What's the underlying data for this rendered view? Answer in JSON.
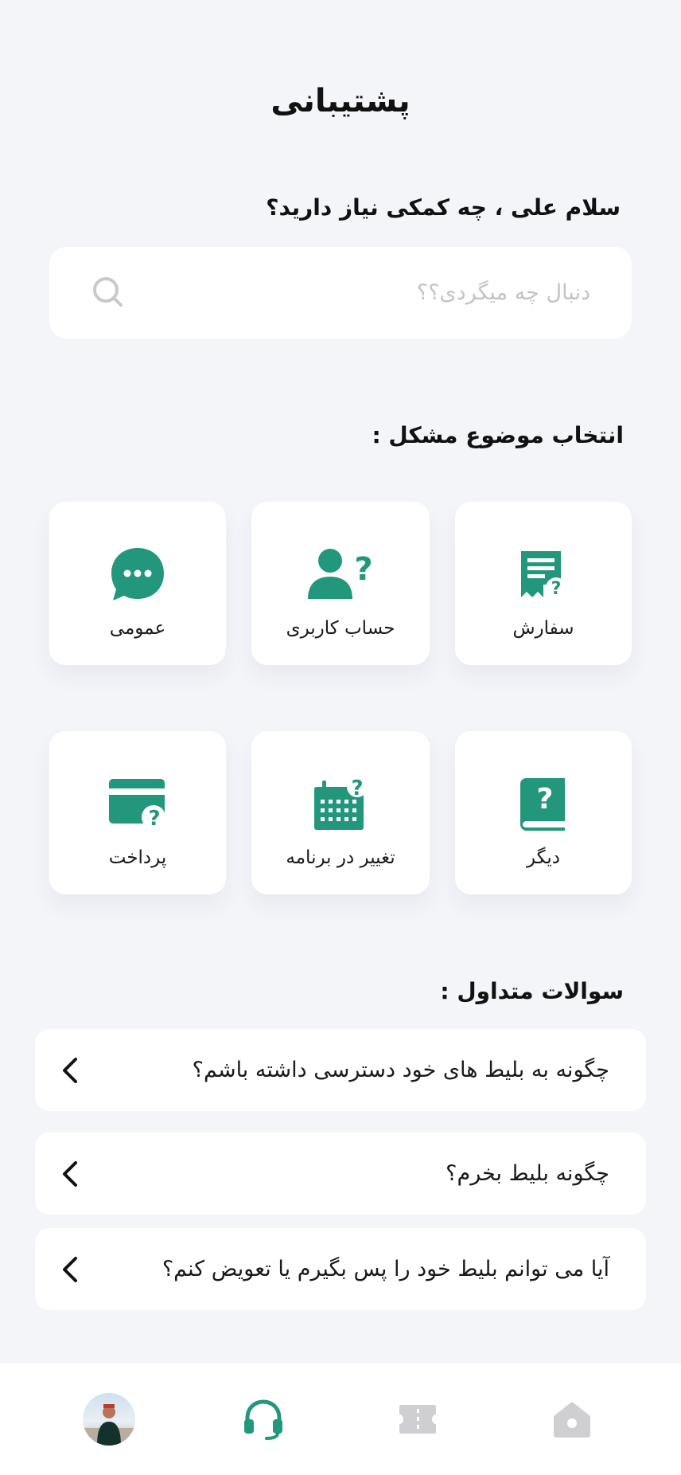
{
  "header": {
    "title": "پشتیبانی"
  },
  "greeting": "سلام علی ، چه کمکی نیاز دارید؟",
  "search": {
    "placeholder": "دنبال چه میگردی؟؟",
    "value": ""
  },
  "topics": {
    "title": "انتخاب موضوع مشکل :",
    "items": [
      {
        "label": "سفارش",
        "icon": "receipt-question-icon"
      },
      {
        "label": "حساب کاربری",
        "icon": "user-question-icon"
      },
      {
        "label": "عمومی",
        "icon": "chat-bubble-icon"
      },
      {
        "label": "دیگر",
        "icon": "book-question-icon"
      },
      {
        "label": "تغییر در برنامه",
        "icon": "calendar-question-icon"
      },
      {
        "label": "پرداخت",
        "icon": "card-question-icon"
      }
    ]
  },
  "faq": {
    "title": "سوالات متداول :",
    "items": [
      {
        "question": "چگونه به بلیط های خود دسترسی داشته باشم؟"
      },
      {
        "question": "چگونه بلیط بخرم؟"
      },
      {
        "question": "آیا می توانم بلیط خود را پس بگیرم یا تعویض کنم؟"
      }
    ]
  },
  "bottom_nav": {
    "items": [
      {
        "icon": "home-icon",
        "active": false
      },
      {
        "icon": "ticket-icon",
        "active": false
      },
      {
        "icon": "headset-icon",
        "active": true
      },
      {
        "icon": "avatar",
        "active": false
      }
    ]
  },
  "colors": {
    "accent": "#23977b",
    "background": "#f4f5f9",
    "inactive_icon": "#cfcfd2"
  }
}
